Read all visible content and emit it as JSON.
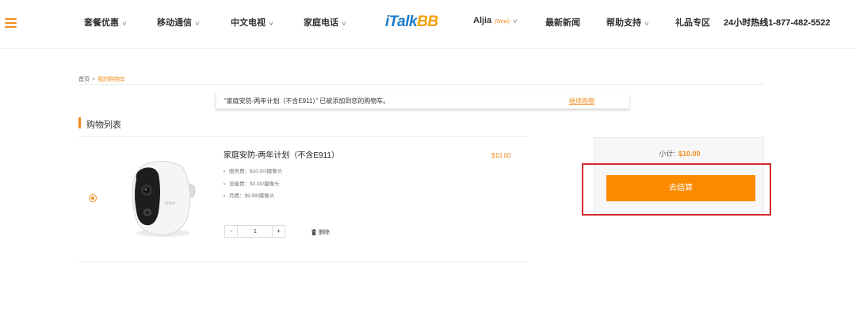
{
  "header": {
    "nav": [
      {
        "label": "套餐优惠",
        "chevron": "∨"
      },
      {
        "label": "移动通信",
        "chevron": "∨"
      },
      {
        "label": "中文电视",
        "chevron": "∨"
      },
      {
        "label": "家庭电话",
        "chevron": "∨"
      }
    ],
    "logo": {
      "part1": "iTalk",
      "part2": "BB"
    },
    "aljia": {
      "label": "Aljia",
      "tag": "(New)",
      "chevron": "∨"
    },
    "news": "最新新闻",
    "help": {
      "label": "帮助支持",
      "chevron": "∨"
    },
    "gifts": "礼品专区",
    "hotline": "24小时热线1-877-482-5522"
  },
  "breadcrumb": {
    "home": "首页",
    "separator": ">",
    "current": "我的购物车"
  },
  "notice": {
    "text": "“家庭安防-两年计划（不含E911）” 已被添加到您的购物车。",
    "link": "继续购物"
  },
  "cart": {
    "title": "购物列表",
    "item": {
      "name": "家庭安防-两年计划（不含E911）",
      "price": "$10.00",
      "specs": [
        "服务费：$10.00/摄像头",
        "设备费：$0.00/摄像头",
        "月费：$9.99/摄像头"
      ],
      "quantity": "1",
      "minus": "-",
      "plus": "+",
      "delete": "删除",
      "camera_brand": "imou"
    }
  },
  "summary": {
    "subtotal_label": "小计:",
    "subtotal_value": "$10.00",
    "checkout": "去结算"
  },
  "colors": {
    "accent": "#fb8a00",
    "highlight": "#d32b2b",
    "logo_blue": "#1a7ac8"
  }
}
